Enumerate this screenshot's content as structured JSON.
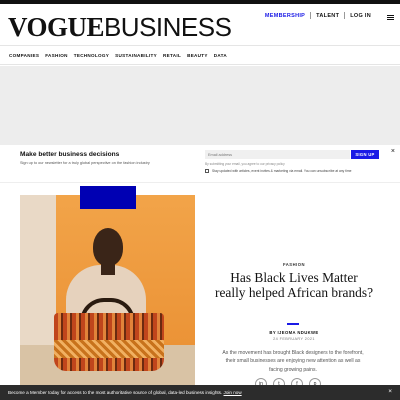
{
  "header": {
    "logo_vogue": "VOGUE",
    "logo_business": "BUSINESS",
    "links": [
      "MEMBERSHIP",
      "TALENT",
      "LOG IN"
    ]
  },
  "nav": {
    "items": [
      "COMPANIES",
      "FASHION",
      "TECHNOLOGY",
      "SUSTAINABILITY",
      "RETAIL",
      "BEAUTY",
      "DATA"
    ]
  },
  "newsletter": {
    "title": "Make better business decisions",
    "subtitle": "Sign up to our newsletter for a truly global perspective on the fashion industry",
    "email_placeholder": "Email address",
    "button_label": "SIGN UP",
    "legal": "By submitting your email, you agree to our privacy policy",
    "checkbox_label": "Stay updated with articles, event invites & marketing via email. You can unsubscribe at any time",
    "close_symbol": "×"
  },
  "article": {
    "kicker": "FASHION",
    "headline": "Has Black Lives Matter really helped African brands?",
    "byline": "BY IJEOMA NDUKWE",
    "date": "24 FEBRUARY 2021",
    "dek": "As the movement has brought Black designers to the forefront, their small businesses are enjoying new attention as well as facing growing pains."
  },
  "share_icons": [
    "linkedin-icon",
    "twitter-icon",
    "facebook-icon",
    "pinterest-icon"
  ],
  "bottom_bar": {
    "text": "Become a Member today for access to the most authoritative source of global, data-led business insights.",
    "link": "Join now",
    "close_symbol": "×"
  },
  "colors": {
    "accent": "#1a1ae6",
    "bottom_bar": "#2c2c2c",
    "hero_tag": "#0000b3"
  }
}
